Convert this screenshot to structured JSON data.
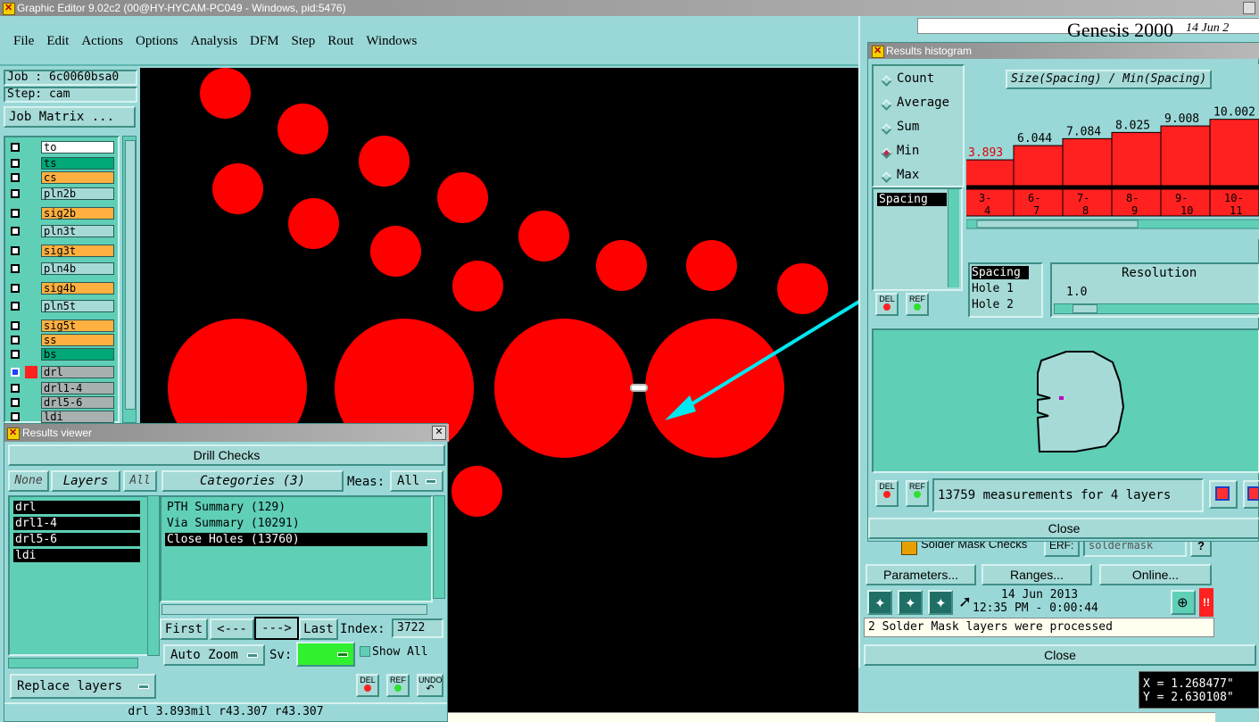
{
  "window": {
    "title": "Graphic Editor 9.02c2 (00@HY-HYCAM-PC049 - Windows, pid:5476)"
  },
  "menu": [
    "File",
    "Edit",
    "Actions",
    "Options",
    "Analysis",
    "DFM",
    "Step",
    "Rout",
    "Windows"
  ],
  "job": {
    "job_label": "Job : 6c0060bsa0",
    "step_label": "Step: cam",
    "matrix_button": "Job Matrix ..."
  },
  "layers": [
    {
      "name": "to",
      "color": "#ffffff"
    },
    {
      "name": "ts",
      "color": "#00a878"
    },
    {
      "name": "cs",
      "color": "#ffb040"
    },
    {
      "name": "pln2b",
      "color": "#a6dad7"
    },
    {
      "name": "sig2b",
      "color": "#ffb040"
    },
    {
      "name": "pln3t",
      "color": "#a6dad7"
    },
    {
      "name": "sig3t",
      "color": "#ffb040"
    },
    {
      "name": "pln4b",
      "color": "#a6dad7"
    },
    {
      "name": "sig4b",
      "color": "#ffb040"
    },
    {
      "name": "pln5t",
      "color": "#a6dad7"
    },
    {
      "name": "sig5t",
      "color": "#ffb040"
    },
    {
      "name": "ss",
      "color": "#ffb040"
    },
    {
      "name": "bs",
      "color": "#00a878"
    },
    {
      "name": "drl",
      "color": "#a8b0b0"
    },
    {
      "name": "drl1-4",
      "color": "#a8b0b0"
    },
    {
      "name": "drl5-6",
      "color": "#a8b0b0"
    },
    {
      "name": "ldi",
      "color": "#a8b0b0"
    }
  ],
  "results_viewer": {
    "title": "Results viewer",
    "header": "Drill Checks",
    "none_btn": "None",
    "layers_btn": "Layers",
    "all_btn": "All",
    "categories_btn": "Categories (3)",
    "meas_label": "Meas:",
    "meas_value": "All",
    "layer_list": [
      "drl",
      "drl1-4",
      "drl5-6",
      "ldi"
    ],
    "categories": [
      "PTH Summary (129)",
      "Via Summary (10291)",
      "Close Holes (13760)"
    ],
    "first_btn": "First",
    "prev_btn": "<---",
    "next_btn": "--->",
    "last_btn": "Last",
    "index_label": "Index:",
    "index_value": "3722",
    "auto_zoom": "Auto Zoom",
    "sv_label": "Sv:",
    "show_all": "Show All",
    "replace_layers": "Replace layers",
    "del": "DEL",
    "ref": "REF",
    "undo": "UNDO",
    "status": "drl 3.893mil   r43.307   r43.307"
  },
  "histogram": {
    "title": "Results histogram",
    "options": [
      "Count",
      "Average",
      "Sum",
      "Min",
      "Max"
    ],
    "selected_option": "Min",
    "chart_title": "Size(Spacing) / Min(Spacing)",
    "field_list": [
      "Spacing"
    ],
    "hole_list": [
      "Spacing",
      "Hole 1",
      "Hole 2"
    ],
    "resolution_label": "Resolution",
    "resolution_value": "1.0",
    "del": "DEL",
    "ref": "REF",
    "measurements": "13759 measurements for 4 layers",
    "close": "Close"
  },
  "chart_data": {
    "type": "bar",
    "title": "Size(Spacing) / Min(Spacing)",
    "categories": [
      [
        "3-",
        "4"
      ],
      [
        "6-",
        "7"
      ],
      [
        "7-",
        "8"
      ],
      [
        "8-",
        "9"
      ],
      [
        "9-",
        "10"
      ],
      [
        "10-",
        "11"
      ]
    ],
    "values": [
      3.893,
      6.044,
      7.084,
      8.025,
      9.008,
      10.002
    ],
    "value_labels": [
      "3.893",
      "6.044",
      "7.084",
      "8.025",
      "9.008",
      "10.002"
    ],
    "highlight_color": "#ff2020"
  },
  "genesis": {
    "title": "Genesis 2000",
    "date_partial": "14 Jun 2"
  },
  "back_panel": {
    "solder_row": "Solder Mask Checks",
    "erf_label": "ERF:",
    "erf_value": "soldermask",
    "help": "?",
    "parameters": "Parameters...",
    "ranges": "Ranges...",
    "online": "Online...",
    "date": "14 Jun 2013",
    "time": "12:35 PM - 0:00:44",
    "alert": "!!",
    "message": "2 Solder Mask layers were processed",
    "close": "Close"
  },
  "coords": {
    "x": "X = 1.268477\"",
    "y": "Y = 2.630108\""
  }
}
